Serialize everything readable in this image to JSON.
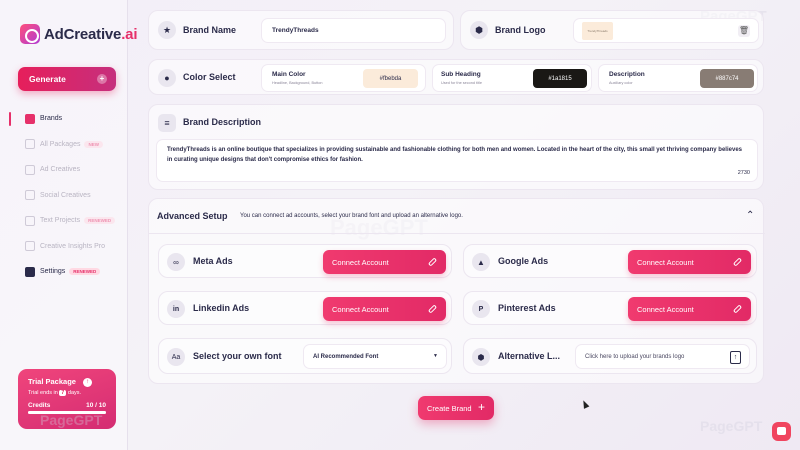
{
  "sidebar": {
    "logo_main": "AdCreative",
    "logo_ai": ".ai",
    "generate_label": "Generate",
    "generate_plus": "+",
    "items": [
      {
        "label": "Brands",
        "badge": ""
      },
      {
        "label": "All Packages",
        "badge": "NEW"
      },
      {
        "label": "Ad Creatives",
        "badge": ""
      },
      {
        "label": "Social Creatives",
        "badge": ""
      },
      {
        "label": "Text Projects",
        "badge": "RENEWED"
      },
      {
        "label": "Creative Insights Pro",
        "badge": ""
      },
      {
        "label": "Settings",
        "badge": "RENEWED"
      }
    ],
    "trial": {
      "title": "Trial Package",
      "ends_prefix": "Trial ends in",
      "days": "7",
      "ends_suffix": "days.",
      "credits_label": "Credits",
      "credits_value": "10 / 10",
      "credits_fraction": 1.0
    }
  },
  "brand": {
    "name_label": "Brand Name",
    "name_value": "TrendyThreads",
    "logo_label": "Brand Logo",
    "logo_thumb_text": "TrendyThreads"
  },
  "colors": {
    "label": "Color Select",
    "main": {
      "title": "Main Color",
      "sub": "Headline, Background, Button",
      "hex": "#fbebda"
    },
    "subheading": {
      "title": "Sub Heading",
      "sub": "Used for the second title",
      "hex": "#1a1815"
    },
    "description": {
      "title": "Description",
      "sub": "Auxiliary color",
      "hex": "#887c74"
    }
  },
  "description": {
    "label": "Brand Description",
    "text": "TrendyThreads is an online boutique that specializes in providing sustainable and fashionable clothing for both men and women. Located in the heart of the city, this small yet thriving company believes in curating unique designs that don't compromise ethics for fashion.",
    "char_count": "2730"
  },
  "advanced": {
    "title": "Advanced Setup",
    "subtitle": "You can connect ad accounts, select your brand font and upload an alternative logo.",
    "connect_label": "Connect Account",
    "meta": "Meta Ads",
    "google": "Google Ads",
    "linkedin": "Linkedin Ads",
    "pinterest": "Pinterest Ads",
    "font_label": "Select your own font",
    "font_value": "AI Recommended Font",
    "alt_logo_label": "Alternative L...",
    "alt_logo_placeholder": "Click here to upload your brands logo"
  },
  "create_label": "Create Brand",
  "create_plus": "+",
  "watermark": "PageGPT",
  "colors_theme": {
    "accent": "#e6306a",
    "text": "#2b2b4a"
  }
}
